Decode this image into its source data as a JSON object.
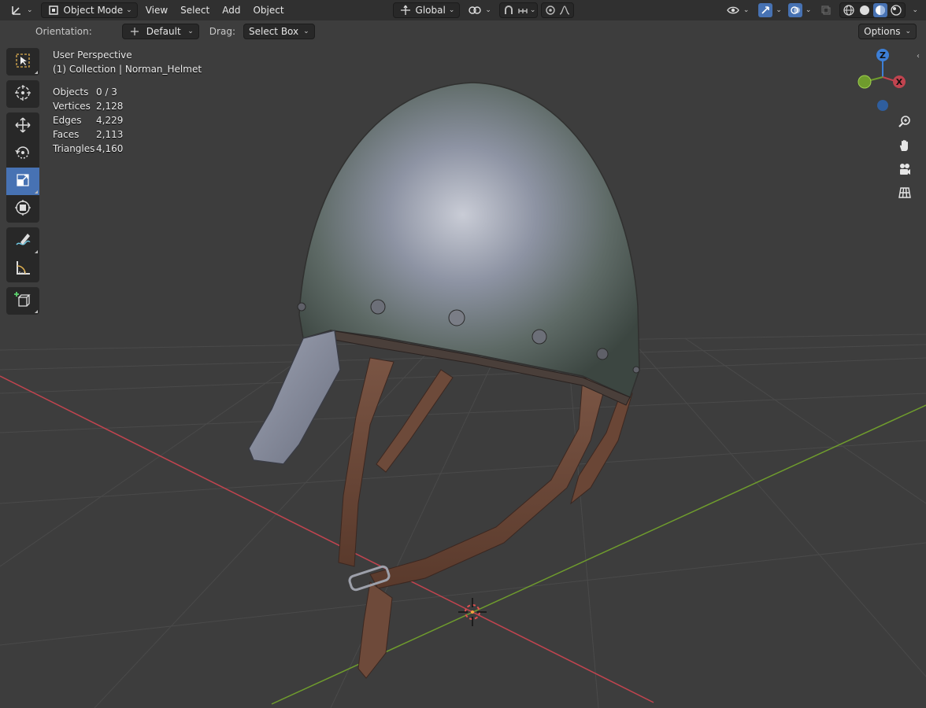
{
  "header": {
    "mode": "Object Mode",
    "menus": [
      "View",
      "Select",
      "Add",
      "Object"
    ],
    "transform_orientation": "Global"
  },
  "tool_settings": {
    "orientation_label": "Orientation:",
    "orientation_value": "Default",
    "drag_label": "Drag:",
    "drag_value": "Select Box",
    "options_label": "Options"
  },
  "overlay": {
    "view_name": "User Perspective",
    "collection": "(1) Collection | Norman_Helmet",
    "stats": [
      {
        "label": "Objects",
        "value": "0 / 3"
      },
      {
        "label": "Vertices",
        "value": "2,128"
      },
      {
        "label": "Edges",
        "value": "4,229"
      },
      {
        "label": "Faces",
        "value": "2,113"
      },
      {
        "label": "Triangles",
        "value": "4,160"
      }
    ]
  },
  "gizmo": {
    "z": "Z",
    "x": "X"
  },
  "colors": {
    "accent": "#4772b3",
    "x_axis": "#c0444f",
    "y_axis": "#6f9c2d",
    "z_axis": "#3d7fd6"
  },
  "icons": {
    "toolshelf": [
      "select-box-icon",
      "cursor-icon",
      "move-icon",
      "rotate-icon",
      "scale-icon",
      "transform-icon",
      "annotate-icon",
      "measure-icon",
      "add-cube-icon"
    ],
    "navigation": [
      "zoom-icon",
      "hand-pan-icon",
      "camera-icon",
      "grid-view-icon"
    ]
  }
}
